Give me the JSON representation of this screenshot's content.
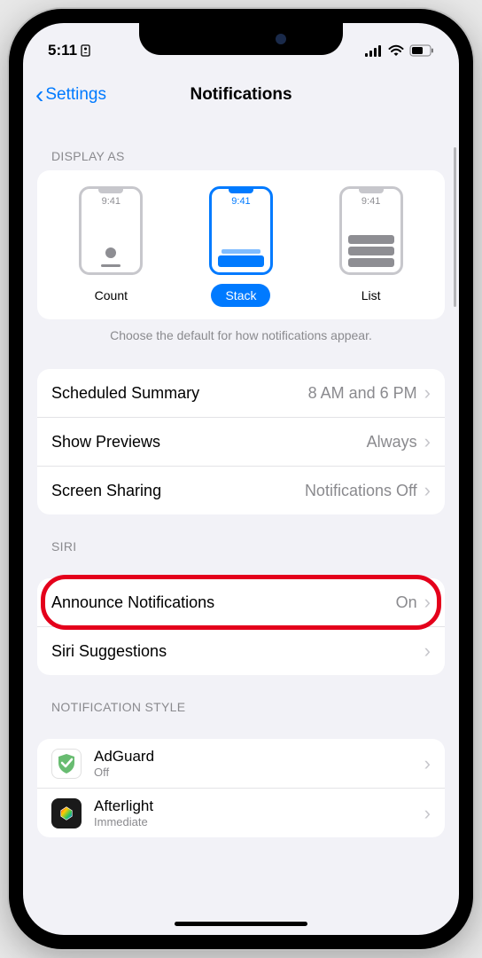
{
  "status": {
    "time": "5:11",
    "signal_bars": 4
  },
  "nav": {
    "back_label": "Settings",
    "title": "Notifications"
  },
  "display_as": {
    "header": "DISPLAY AS",
    "mock_time": "9:41",
    "options": [
      {
        "label": "Count"
      },
      {
        "label": "Stack"
      },
      {
        "label": "List"
      }
    ],
    "footer": "Choose the default for how notifications appear."
  },
  "main_rows": {
    "scheduled_summary": {
      "label": "Scheduled Summary",
      "value": "8 AM and 6 PM"
    },
    "show_previews": {
      "label": "Show Previews",
      "value": "Always"
    },
    "screen_sharing": {
      "label": "Screen Sharing",
      "value": "Notifications Off"
    }
  },
  "siri": {
    "header": "SIRI",
    "announce": {
      "label": "Announce Notifications",
      "value": "On"
    },
    "suggestions": {
      "label": "Siri Suggestions"
    }
  },
  "style": {
    "header": "NOTIFICATION STYLE",
    "apps": [
      {
        "name": "AdGuard",
        "sub": "Off"
      },
      {
        "name": "Afterlight",
        "sub": "Immediate"
      }
    ]
  }
}
